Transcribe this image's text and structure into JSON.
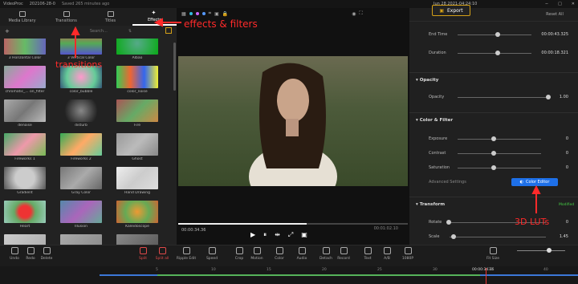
{
  "app": {
    "name": "VideoProc",
    "project": "202106-28-0",
    "saved": "Saved 265 minutes ago",
    "datetime": "Jun 28 2021-04:24:10"
  },
  "left_tabs": [
    {
      "label": "Media Library"
    },
    {
      "label": "Transitions"
    },
    {
      "label": "Titles"
    },
    {
      "label": "Effects"
    }
  ],
  "search_placeholder": "Search...",
  "effects": [
    {
      "label": "3 Horizontal Color",
      "grad": "linear-gradient(90deg,#b66 0%,#6b6 50%,#66b 100%)"
    },
    {
      "label": "3 Vertical Color",
      "grad": "linear-gradient(180deg,#c55,#5a5,#55c)"
    },
    {
      "label": "Albao",
      "grad": "radial-gradient(circle,#5a8 0%,#1a2 90%)"
    },
    {
      "label": "chromatic_... on_filter",
      "grad": "linear-gradient(135deg,#8a9,#d7c,#9ac)"
    },
    {
      "label": "color_bubble",
      "grad": "radial-gradient(circle,#f9c,#6c9 60%,#357)"
    },
    {
      "label": "color_noise",
      "grad": "linear-gradient(90deg,#3c5,#e63,#36e,#ee3)"
    },
    {
      "label": "denoise",
      "grad": "linear-gradient(135deg,#aaa,#777,#bbb)"
    },
    {
      "label": "disturb",
      "grad": "radial-gradient(circle,#888,#222 70%)"
    },
    {
      "label": "Fire",
      "grad": "linear-gradient(135deg,#a55,#6a6,#c84)"
    },
    {
      "label": "Fireworks 1",
      "grad": "linear-gradient(135deg,#4a6,#e9a,#7b5)"
    },
    {
      "label": "Fireworks 2",
      "grad": "linear-gradient(135deg,#3a5,#fa6,#6c9)"
    },
    {
      "label": "Ghost",
      "grad": "linear-gradient(135deg,#999,#bbb,#888)"
    },
    {
      "label": "Gradient",
      "grad": "radial-gradient(circle,#ccc 40%,#555)"
    },
    {
      "label": "Gray Color",
      "grad": "linear-gradient(135deg,#777,#aaa,#666)"
    },
    {
      "label": "Hand Drawing",
      "grad": "linear-gradient(135deg,#eee,#ccc,#ddd)"
    },
    {
      "label": "Heart",
      "grad": "radial-gradient(circle,#e33 25%,#6a6 45%,#9cb)"
    },
    {
      "label": "Illusion",
      "grad": "linear-gradient(135deg,#58a,#a6b,#6a9)"
    },
    {
      "label": "Kaleidoscope",
      "grad": "radial-gradient(circle,#e93,#6a5 50%,#c63)"
    },
    {
      "label": "",
      "grad": "linear-gradient(135deg,#ccc,#aaa)"
    },
    {
      "label": "",
      "grad": "linear-gradient(135deg,#aaa,#888)"
    },
    {
      "label": "",
      "grad": "linear-gradient(135deg,#888,#555)"
    }
  ],
  "preview": {
    "timecode": "00:00:34.36",
    "total": "00:01:02.10",
    "progress": 0.56
  },
  "right": {
    "fold_all": "Fold All",
    "reset_all": "Reset All",
    "end_time_label": "End Time",
    "end_time": "00:00:43.325",
    "duration_label": "Duration",
    "duration": "00:00:18.321",
    "opacity_section": "Opacity",
    "opacity_label": "Opacity",
    "opacity_val": "1.00",
    "color_section": "Color & Filter",
    "exposure_label": "Exposure",
    "exposure_val": "0",
    "contrast_label": "Contrast",
    "contrast_val": "0",
    "saturation_label": "Saturation",
    "saturation_val": "0",
    "advanced": "Advanced Settings",
    "color_editor": "Color Editor",
    "transform_section": "Transform",
    "modified": "Modified",
    "rotate_label": "Rotate",
    "rotate_val": "0",
    "scale_label": "Scale",
    "scale_val": "1.45"
  },
  "toolbar": [
    {
      "label": "Undo"
    },
    {
      "label": "Redo"
    },
    {
      "label": "Delete"
    },
    {
      "label": "Split",
      "red": true
    },
    {
      "label": "Split all",
      "red": true
    },
    {
      "label": "Ripple Edit"
    },
    {
      "label": "Speed"
    },
    {
      "label": "Crop"
    },
    {
      "label": "Motion"
    },
    {
      "label": "Color"
    },
    {
      "label": "Audio"
    },
    {
      "label": "Detach"
    },
    {
      "label": "Record"
    },
    {
      "label": "Text"
    },
    {
      "label": "A/B"
    },
    {
      "label": "1080P"
    },
    {
      "label": "Fit Size"
    }
  ],
  "export_label": "Export",
  "ruler": {
    "ticks": [
      "5",
      "10",
      "15",
      "20",
      "25",
      "30",
      "35",
      "40"
    ],
    "playhead": "00:00:34.36"
  },
  "annotations": {
    "effects": "effects & filters",
    "transitions": "transitions",
    "lut": "3D LUTs"
  },
  "colors": {
    "accent": "#1e70e8",
    "annotation": "#ff2a2a",
    "export_border": "#d4a017"
  }
}
